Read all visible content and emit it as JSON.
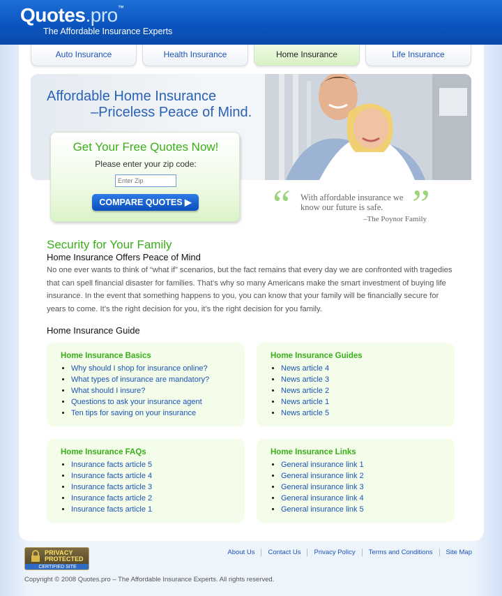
{
  "header": {
    "logo_main": "Quotes",
    "logo_tld": ".pro",
    "logo_tm": "™",
    "tagline": "The Affordable Insurance Experts"
  },
  "tabs": [
    {
      "label": "Auto Insurance",
      "active": false
    },
    {
      "label": "Health Insurance",
      "active": false
    },
    {
      "label": "Home Insurance",
      "active": true
    },
    {
      "label": "Life Insurance",
      "active": false
    }
  ],
  "hero": {
    "title": "Affordable Home Insurance",
    "subtitle": "–Priceless Peace of Mind."
  },
  "quote_form": {
    "title": "Get Your Free Quotes Now!",
    "prompt": "Please enter your zip code:",
    "zip_placeholder": "Enter Zip",
    "button_label": "COMPARE QUOTES"
  },
  "testimonial": {
    "text": "With affordable insurance we know our future is safe.",
    "author": "–The Poynor Family"
  },
  "security": {
    "title": "Security for Your Family",
    "subtitle": "Home Insurance Offers Peace of Mind",
    "body": "No one ever wants to think of “what if” scenarios, but the fact remains that every day we are confronted with tragedies that can spell financial disaster for families. That’s why so many Americans make the smart investment of buying life insurance. In the event that something happens to you, you can know that your family will be financially secure for years to come. It’s the right decision for you, it’s the right decision for you family."
  },
  "guide": {
    "title": "Home Insurance Guide",
    "boxes": [
      {
        "title": "Home Insurance Basics",
        "items": [
          "Why should I shop for insurance online?",
          "What types of insurance are mandatory?",
          "What should I insure?",
          "Questions to ask your insurance agent",
          "Ten tips for saving on your insurance"
        ]
      },
      {
        "title": "Home Insurance Guides",
        "items": [
          "News article 4",
          "News article 3",
          "News article 2",
          "News article 1",
          "News article 5"
        ]
      },
      {
        "title": "Home Insurance FAQs",
        "items": [
          "Insurance facts article 5",
          "Insurance facts article 4",
          "Insurance facts article 3",
          "Insurance facts article 2",
          "Insurance facts article 1"
        ]
      },
      {
        "title": "Home Insurance Links",
        "items": [
          "General insurance link 1",
          "General insurance link 2",
          "General insurance link 3",
          "General insurance link 4",
          "General insurance link 5"
        ]
      }
    ]
  },
  "footer": {
    "badge": {
      "line1": "PRIVACY",
      "line2": "PROTECTED",
      "line3": "CERTIFIED SITE"
    },
    "links": [
      "About Us",
      "Contact Us",
      "Privacy Policy",
      "Terms and Conditions",
      "Site Map"
    ],
    "copyright": "Copyright © 2008 Quotes.pro – The Affordable Insurance Experts. All rights reserved."
  },
  "colors": {
    "brand_blue": "#0b55c0",
    "accent_green": "#3aae1a",
    "link_blue": "#1b52b8"
  }
}
